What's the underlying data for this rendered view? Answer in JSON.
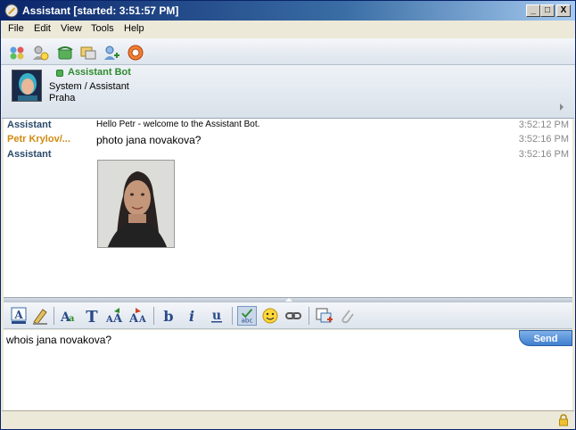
{
  "window": {
    "title": "Assistant [started: 3:51:57 PM]",
    "min_label": "_",
    "max_label": "□",
    "close_label": "X"
  },
  "menu": [
    "File",
    "Edit",
    "View",
    "Tools",
    "Help"
  ],
  "toolbar": {
    "icons": [
      "contacts-icon",
      "user-info-icon",
      "phone-icon",
      "message-icon",
      "add-contact-icon",
      "web-icon"
    ]
  },
  "contact": {
    "name": "Assistant Bot",
    "line1": "System / Assistant",
    "line2": "Praha",
    "status_color": "#4caf50"
  },
  "messages": [
    {
      "sender": "Assistant",
      "sender_color": "#2a4a6a",
      "text": "Hello Petr - welcome to the Assistant Bot.",
      "time": "3:52:12 PM"
    },
    {
      "sender": "Petr Krylov/...",
      "sender_color": "#d08a10",
      "text": "photo jana novakova?",
      "time": "3:52:16 PM"
    },
    {
      "sender": "Assistant",
      "sender_color": "#2a4a6a",
      "text": "",
      "time": "3:52:16 PM"
    }
  ],
  "input": {
    "value": "whois jana novakova?",
    "send_label": "Send"
  },
  "colors": {
    "title_bar": "#0a246a",
    "send_button": "#3f7fcf"
  }
}
